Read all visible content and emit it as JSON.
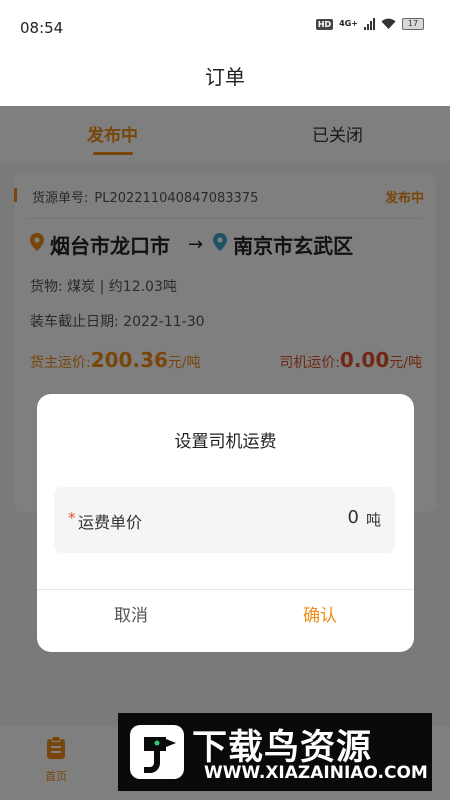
{
  "status_bar": {
    "time": "08:54",
    "hd": "HD",
    "network": "4G+",
    "battery": "17"
  },
  "header": {
    "title": "订单"
  },
  "tabs": [
    {
      "label": "发布中",
      "active": true
    },
    {
      "label": "已关闭",
      "active": false
    }
  ],
  "order": {
    "id_label": "货源单号:",
    "id_value": "PL202211040847083375",
    "status": "发布中",
    "origin": "烟台市龙口市",
    "destination": "南京市玄武区",
    "cargo": "货物:  煤炭 | 约12.03吨",
    "deadline": "装车截止日期:  2022-11-30",
    "owner_price_label": "货主运价:",
    "owner_price_value": "200.36",
    "owner_price_unit": "元/吨",
    "driver_price_label": "司机运价:",
    "driver_price_value": "0.00",
    "driver_price_unit": "元/吨"
  },
  "dialog": {
    "title": "设置司机运费",
    "required_mark": "*",
    "field_label": "运费单价",
    "field_value": "0",
    "field_unit": "吨",
    "cancel_label": "取消",
    "confirm_label": "确认"
  },
  "bottom_nav": {
    "home_label": "首页"
  },
  "watermark": {
    "title": "下载鸟资源",
    "url": "WWW.XIAZAINIAO.COM"
  },
  "colors": {
    "accent": "#f08c17",
    "driver_price": "#e0502a"
  }
}
